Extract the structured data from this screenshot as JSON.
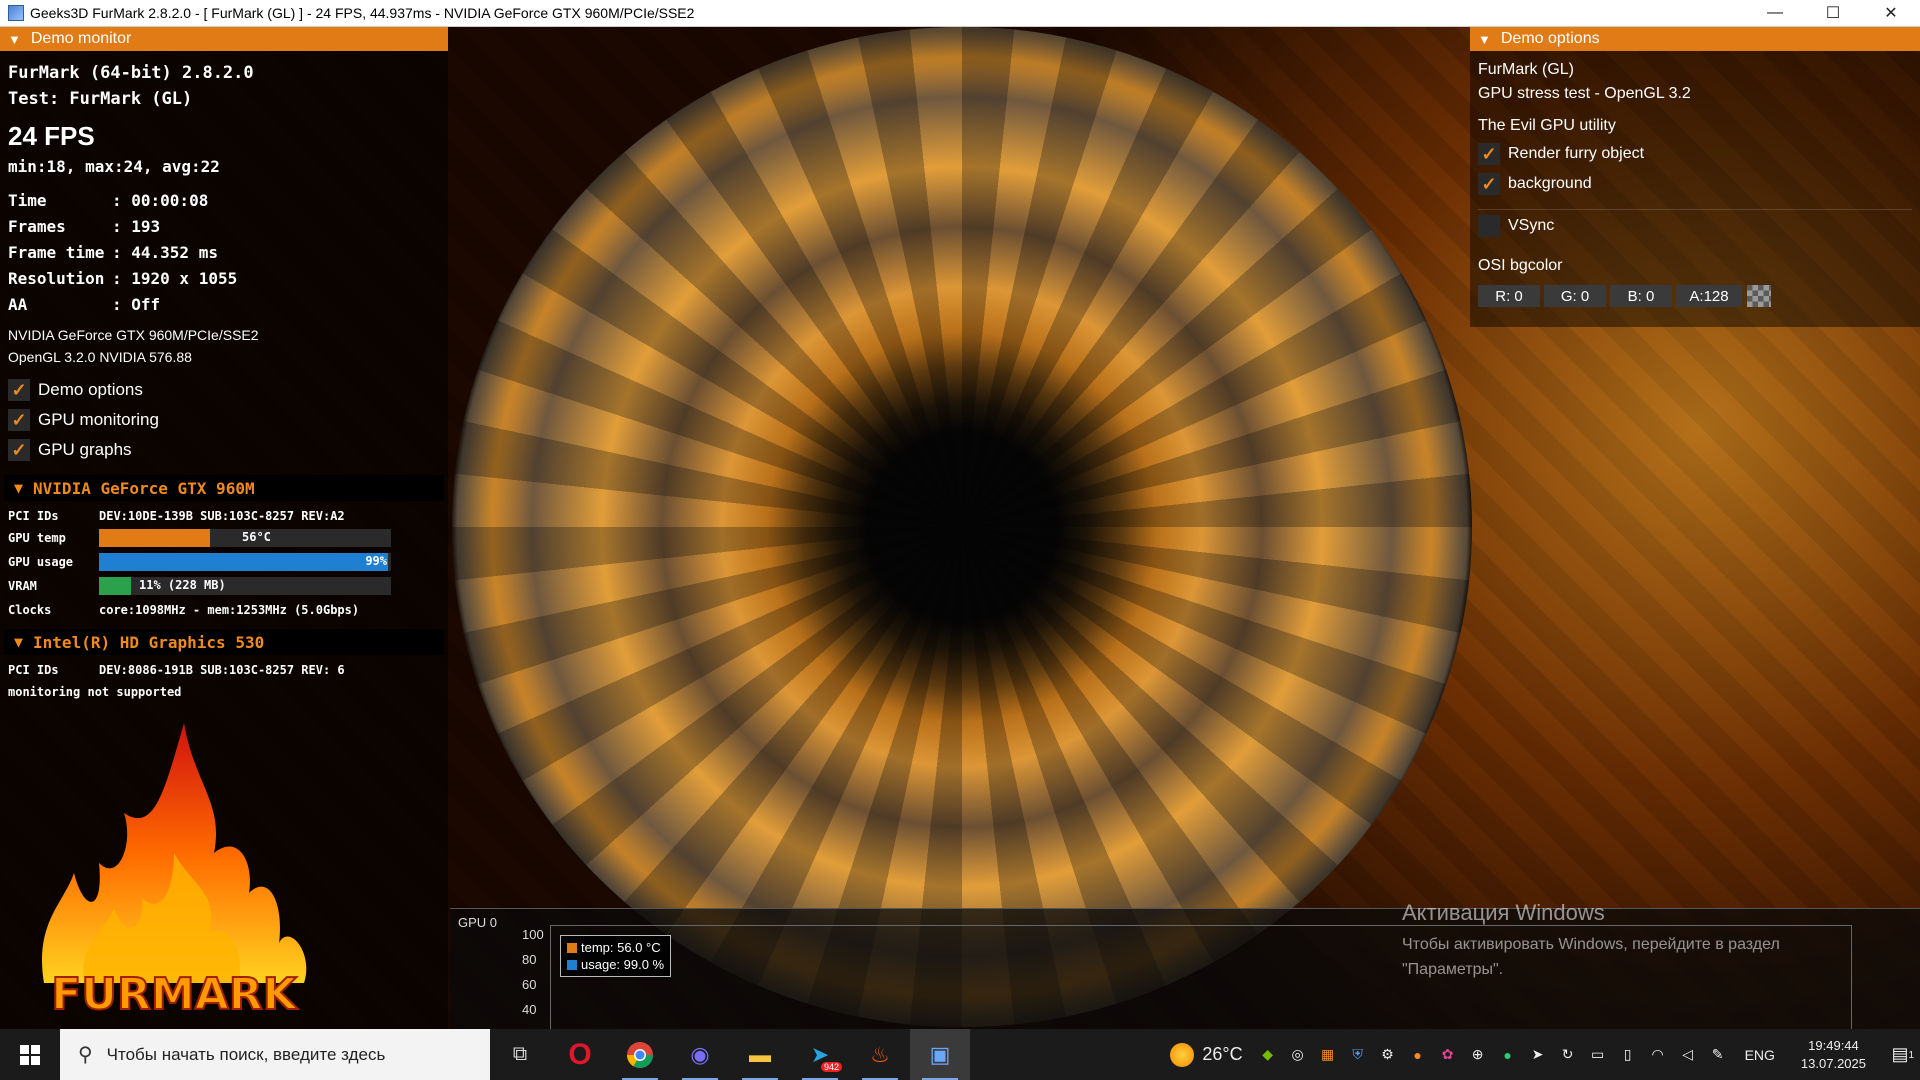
{
  "window": {
    "title": "Geeks3D FurMark 2.8.2.0 - [ FurMark (GL) ] - 24 FPS, 44.937ms - NVIDIA GeForce GTX 960M/PCIe/SSE2",
    "minimize": "—",
    "maximize": "☐",
    "close": "✕"
  },
  "demo_monitor": {
    "header": "Demo monitor",
    "app_version": "FurMark (64-bit) 2.8.2.0",
    "test": "Test: FurMark (GL)",
    "fps": "24 FPS",
    "fps_stats": "min:18, max:24, avg:22",
    "stats": [
      {
        "key": "Time",
        "value": ": 00:00:08"
      },
      {
        "key": "Frames",
        "value": ": 193"
      },
      {
        "key": "Frame time",
        "value": ": 44.352 ms"
      },
      {
        "key": "Resolution",
        "value": ": 1920 x 1055"
      },
      {
        "key": "AA",
        "value": ": Off"
      }
    ],
    "renderer": "NVIDIA GeForce GTX 960M/PCIe/SSE2",
    "opengl": "OpenGL 3.2.0 NVIDIA 576.88",
    "options": [
      {
        "label": "Demo options",
        "checked": true
      },
      {
        "label": "GPU monitoring",
        "checked": true
      },
      {
        "label": "GPU graphs",
        "checked": true
      }
    ],
    "check_glyph": "✓"
  },
  "gpu1": {
    "name": "NVIDIA GeForce GTX 960M",
    "pci_label": "PCI IDs",
    "pci_value": "DEV:10DE-139B SUB:103C-8257 REV:A2",
    "temp_label": "GPU temp",
    "temp_value": "56°C",
    "temp_fraction": 0.38,
    "usage_label": "GPU usage",
    "usage_value": "99%",
    "usage_fraction": 0.99,
    "vram_label": "VRAM",
    "vram_value": "11% (228 MB)",
    "vram_fraction": 0.11,
    "clocks_label": "Clocks",
    "clocks_value": "core:1098MHz - mem:1253MHz (5.0Gbps)",
    "colors": {
      "temp": "#e07b16",
      "usage": "#1f7fd0",
      "vram": "#2aa14a"
    }
  },
  "gpu2": {
    "name": "Intel(R) HD Graphics 530",
    "pci_label": "PCI IDs",
    "pci_value": "DEV:8086-191B SUB:103C-8257 REV: 6",
    "note": "monitoring not supported"
  },
  "logo_text": "FURMARK",
  "demo_options": {
    "header": "Demo options",
    "name": "FurMark (GL)",
    "desc": "GPU stress test - OpenGL 3.2",
    "tagline": "The Evil GPU utility",
    "render_furry": {
      "label": "Render furry object",
      "checked": true
    },
    "background": {
      "label": "background",
      "checked": true
    },
    "vsync": {
      "label": "VSync",
      "checked": false
    },
    "osi_label": "OSI bgcolor",
    "r": "R: 0",
    "g": "G: 0",
    "b": "B: 0",
    "a": "A:128"
  },
  "graph": {
    "label": "GPU 0",
    "y_ticks": [
      "100",
      "80",
      "60",
      "40"
    ],
    "legend": [
      {
        "text": "temp: 56.0 °C",
        "color": "#e07b16"
      },
      {
        "text": "usage: 99.0 %",
        "color": "#1f7fd0"
      }
    ]
  },
  "activation": {
    "heading": "Активация Windows",
    "text": "Чтобы активировать Windows, перейдите в раздел \"Параметры\"."
  },
  "taskbar": {
    "search_placeholder": "Чтобы начать поиск, введите здесь",
    "telegram_badge": "942",
    "temperature": "26°C",
    "language": "ENG",
    "time": "19:49:44",
    "date": "13.07.2025",
    "notifications": "1"
  }
}
